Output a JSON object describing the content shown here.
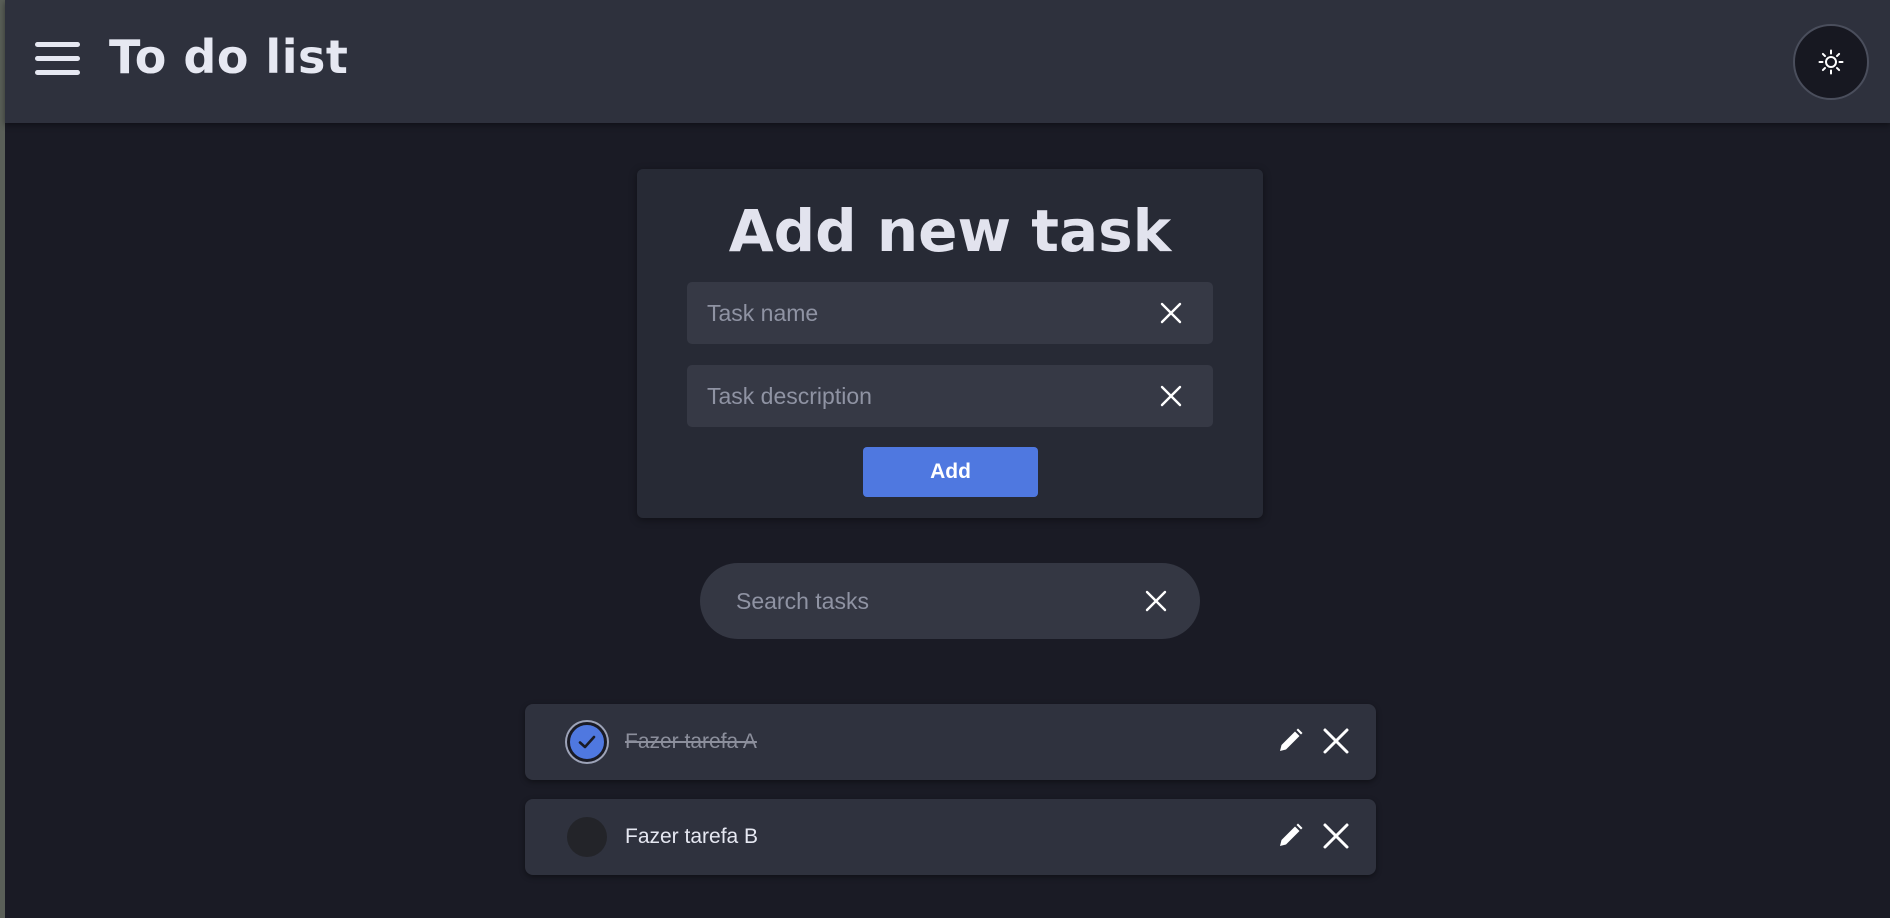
{
  "header": {
    "title": "To do list",
    "menu_icon": "hamburger-menu-icon",
    "theme_icon": "sun-icon"
  },
  "add_task": {
    "title": "Add new task",
    "name_placeholder": "Task name",
    "name_value": "",
    "description_placeholder": "Task description",
    "description_value": "",
    "add_label": "Add"
  },
  "search": {
    "placeholder": "Search tasks",
    "value": ""
  },
  "tasks": [
    {
      "name": "Fazer tarefa A",
      "completed": true
    },
    {
      "name": "Fazer tarefa B",
      "completed": false
    }
  ],
  "colors": {
    "background": "#1a1b25",
    "header": "#2e313d",
    "card": "#272a35",
    "input": "#363945",
    "accent": "#4f78e0",
    "text": "#e6e8f2",
    "placeholder": "#8f93a3"
  }
}
